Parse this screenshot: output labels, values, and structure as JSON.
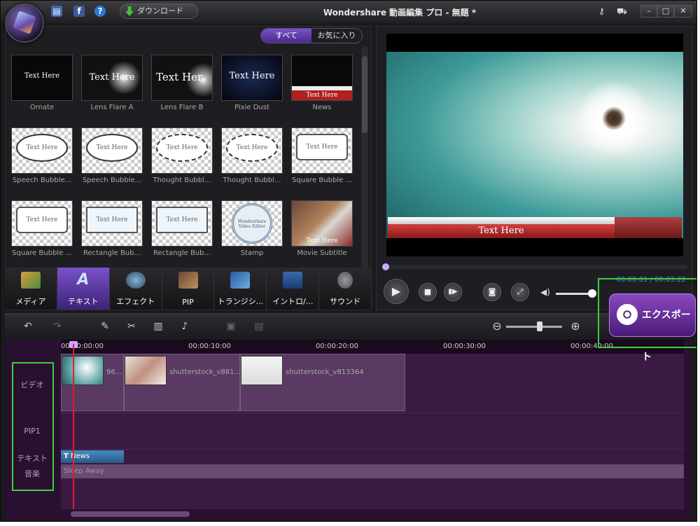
{
  "titlebar": {
    "title": "Wondershare 動画編集 プロ - 無題 *",
    "download_label": "ダウンロード",
    "facebook_icon": "f",
    "help_icon": "?",
    "minimize": "–",
    "maximize": "□",
    "close": "✕"
  },
  "filter": {
    "all": "すべて",
    "favorites": "お気に入り"
  },
  "templates": [
    {
      "label": "Ornate",
      "text": "Text Here"
    },
    {
      "label": "Lens Flare A",
      "text": "Text Here"
    },
    {
      "label": "Lens Flare B",
      "text": "Text Her"
    },
    {
      "label": "Pixie Dust",
      "text": "Text Here"
    },
    {
      "label": "News",
      "text": "Text Here"
    },
    {
      "label": "Speech Bubble...",
      "text": "Text Here"
    },
    {
      "label": "Speech Bubble...",
      "text": "Text Here"
    },
    {
      "label": "Thought Bubbl...",
      "text": "Text Here"
    },
    {
      "label": "Thought Bubbl...",
      "text": "Text Here"
    },
    {
      "label": "Square Bubble ...",
      "text": "Text Here"
    },
    {
      "label": "Square Bubble ...",
      "text": "Text Here"
    },
    {
      "label": "Rectangle Bub...",
      "text": "Text Here"
    },
    {
      "label": "Rectangle Bub...",
      "text": "Text Here"
    },
    {
      "label": "Stamp",
      "text": "Wondershare Video Editor"
    },
    {
      "label": "Movie Subtitle",
      "text": "Text Here"
    }
  ],
  "categories": [
    "メディア",
    "テキスト",
    "エフェクト",
    "PIP",
    "トランジシ...",
    "イントロ/...",
    "サウンド"
  ],
  "preview": {
    "overlay_text": "Text Here",
    "timecode": "00:00:01 / 00:03:22"
  },
  "export": {
    "label": "エクスポート"
  },
  "timeline": {
    "ruler": [
      "00:00:00:00",
      "00:00:10:00",
      "00:00:20:00",
      "00:00:30:00",
      "00:00:40:00"
    ],
    "tracks": [
      "ビデオ",
      "PIP1",
      "テキスト",
      "音楽"
    ],
    "clips": [
      "96...",
      "shutterstock_v881...",
      "shutterstock_v813364"
    ],
    "text_clip": "News",
    "text_clip_icon": "T",
    "music_clip": "Sleep Away"
  },
  "colors": {
    "accent": "#7a52c8",
    "highlight_box": "#3ad23a",
    "timeline_bg": "#3a1a42"
  }
}
